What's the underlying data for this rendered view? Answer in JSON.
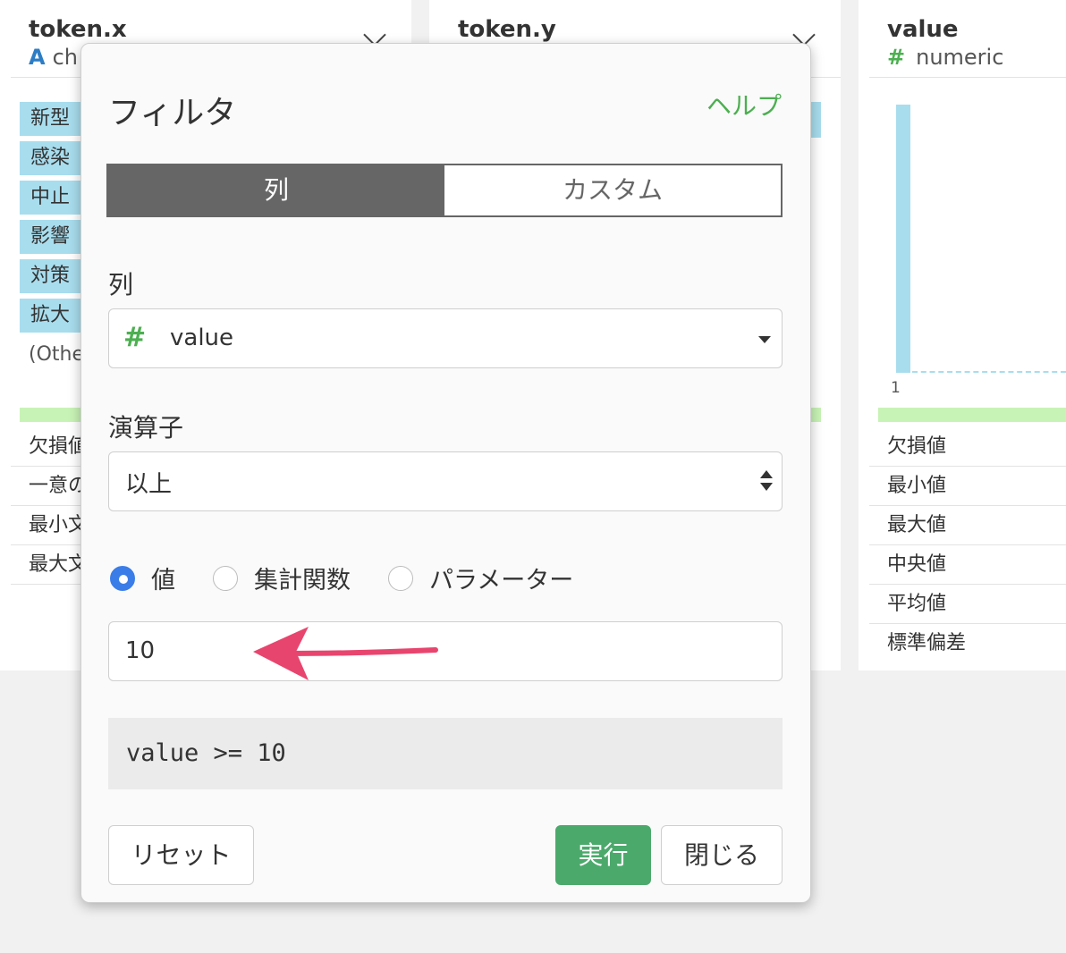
{
  "columns": [
    {
      "title": "token.x",
      "type_icon": "A",
      "type_label": "ch"
    },
    {
      "title": "token.y"
    },
    {
      "title": "value",
      "type_icon": "#",
      "type_label": "numeric"
    }
  ],
  "tokens": [
    "新型",
    "感染",
    "中止",
    "影響",
    "対策",
    "拡大"
  ],
  "tokens_other": "(Othe",
  "stats_col1": [
    "欠損値",
    "一意の",
    "最小文",
    "最大文"
  ],
  "stats_col3": [
    "欠損値",
    "最小値",
    "最大値",
    "中央値",
    "平均値",
    "標準偏差"
  ],
  "histogram": {
    "tick": "1",
    "bar_fraction": 1.0
  },
  "dialog": {
    "title": "フィルタ",
    "help": "ヘルプ",
    "tabs": [
      {
        "label": "列",
        "active": true
      },
      {
        "label": "カスタム",
        "active": false
      }
    ],
    "column_label": "列",
    "column_value": "value",
    "column_type_icon": "#",
    "operator_label": "演算子",
    "operator_value": "以上",
    "radios": [
      {
        "label": "値",
        "checked": true
      },
      {
        "label": "集計関数",
        "checked": false
      },
      {
        "label": "パラメーター",
        "checked": false
      }
    ],
    "value_input": "10",
    "preview": "value >= 10",
    "buttons": {
      "reset": "リセット",
      "run": "実行",
      "close": "閉じる"
    }
  },
  "colors": {
    "accent_green": "#4caf50",
    "run_button": "#4ca96c",
    "token_bg": "#a8ddee",
    "radio_checked": "#3a7de8",
    "arrow": "#e8456e"
  }
}
